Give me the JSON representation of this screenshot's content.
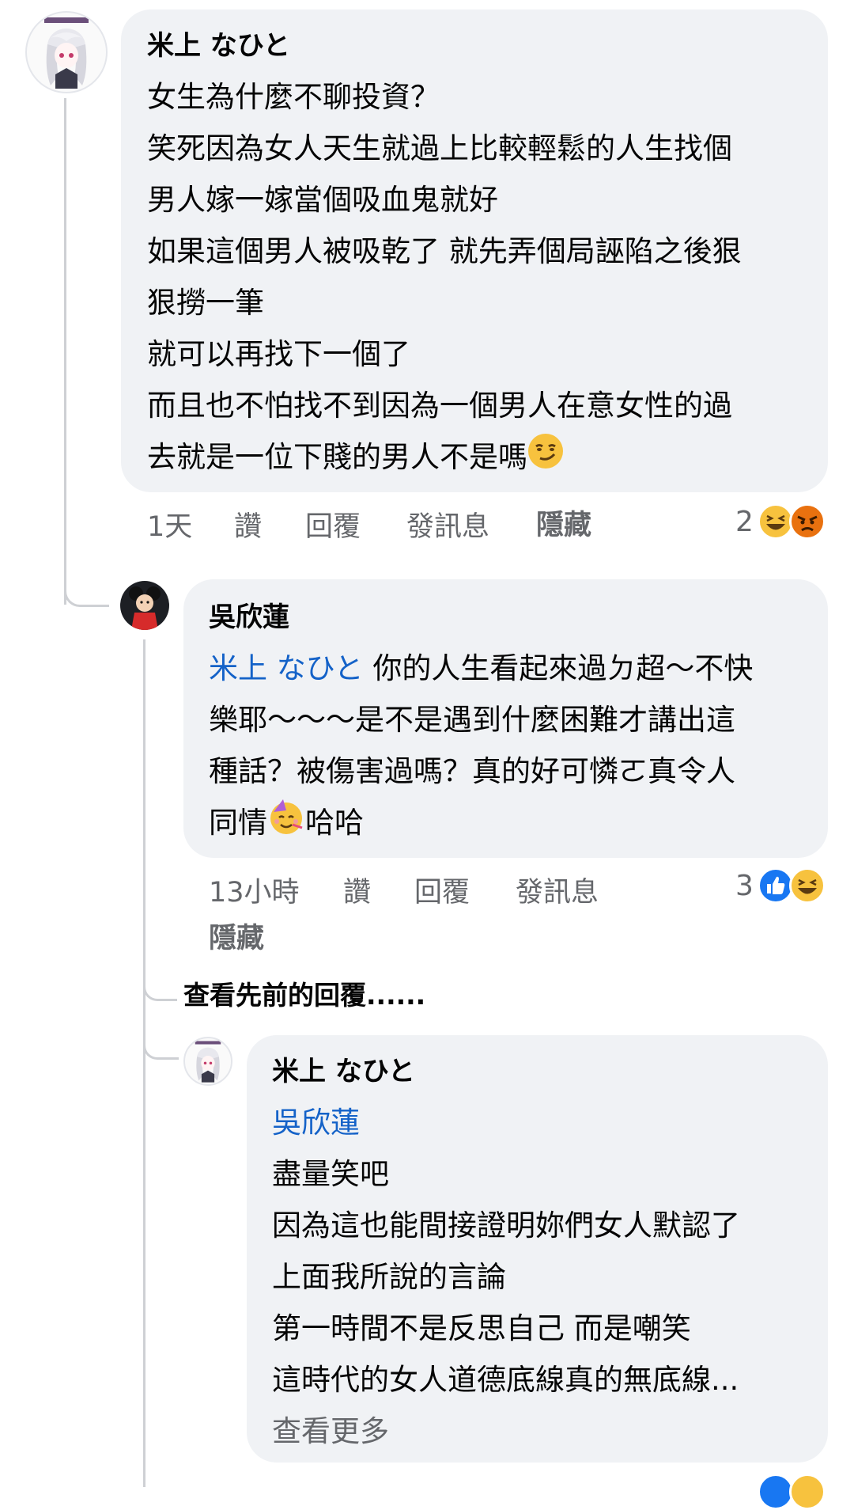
{
  "comment1": {
    "author": "米上 なひと",
    "lines": [
      "女生為什麼不聊投資？",
      "笑死因為女人天生就過上比較輕鬆的人生找個",
      "男人嫁一嫁當個吸血鬼就好",
      "如果這個男人被吸乾了 就先弄個局誣陷之後狠",
      "狠撈一筆",
      "就可以再找下一個了",
      "而且也不怕找不到因為一個男人在意女性的過",
      "去就是一位下賤的男人不是嗎"
    ],
    "time": "1天",
    "like": "讚",
    "reply": "回覆",
    "message": "發訊息",
    "hide": "隱藏",
    "reaction_count": "2",
    "reaction_icons": [
      "laugh-emoji",
      "angry-emoji"
    ]
  },
  "comment2": {
    "author": "吳欣蓮",
    "mention": "米上 なひと",
    "line1_rest": " 你的人生看起來過ㄉ超～不快",
    "lines": [
      "樂耶～～～是不是遇到什麼困難才講出這",
      "種話？被傷害過嗎？真的好可憐ㄛ真令人"
    ],
    "last_line_before_emoji": "同情",
    "last_line_after_emoji": "哈哈",
    "time": "13小時",
    "like": "讚",
    "reply": "回覆",
    "message": "發訊息",
    "hide": "隱藏",
    "reaction_count": "3",
    "reaction_icons": [
      "like-emoji",
      "laugh-emoji"
    ]
  },
  "view_previous": "查看先前的回覆......",
  "comment3": {
    "author": "米上 なひと",
    "mention": "吳欣蓮",
    "lines": [
      "盡量笑吧",
      "因為這也能間接證明妳們女人默認了",
      "上面我所說的言論",
      "第一時間不是反思自己 而是嘲笑",
      "這時代的女人道德底線真的無底線..."
    ],
    "see_more": "查看更多"
  },
  "colors": {
    "bubble": "#f0f2f5",
    "mention": "#1462c8",
    "meta": "#65676b",
    "thread_line": "#ced0d4"
  }
}
